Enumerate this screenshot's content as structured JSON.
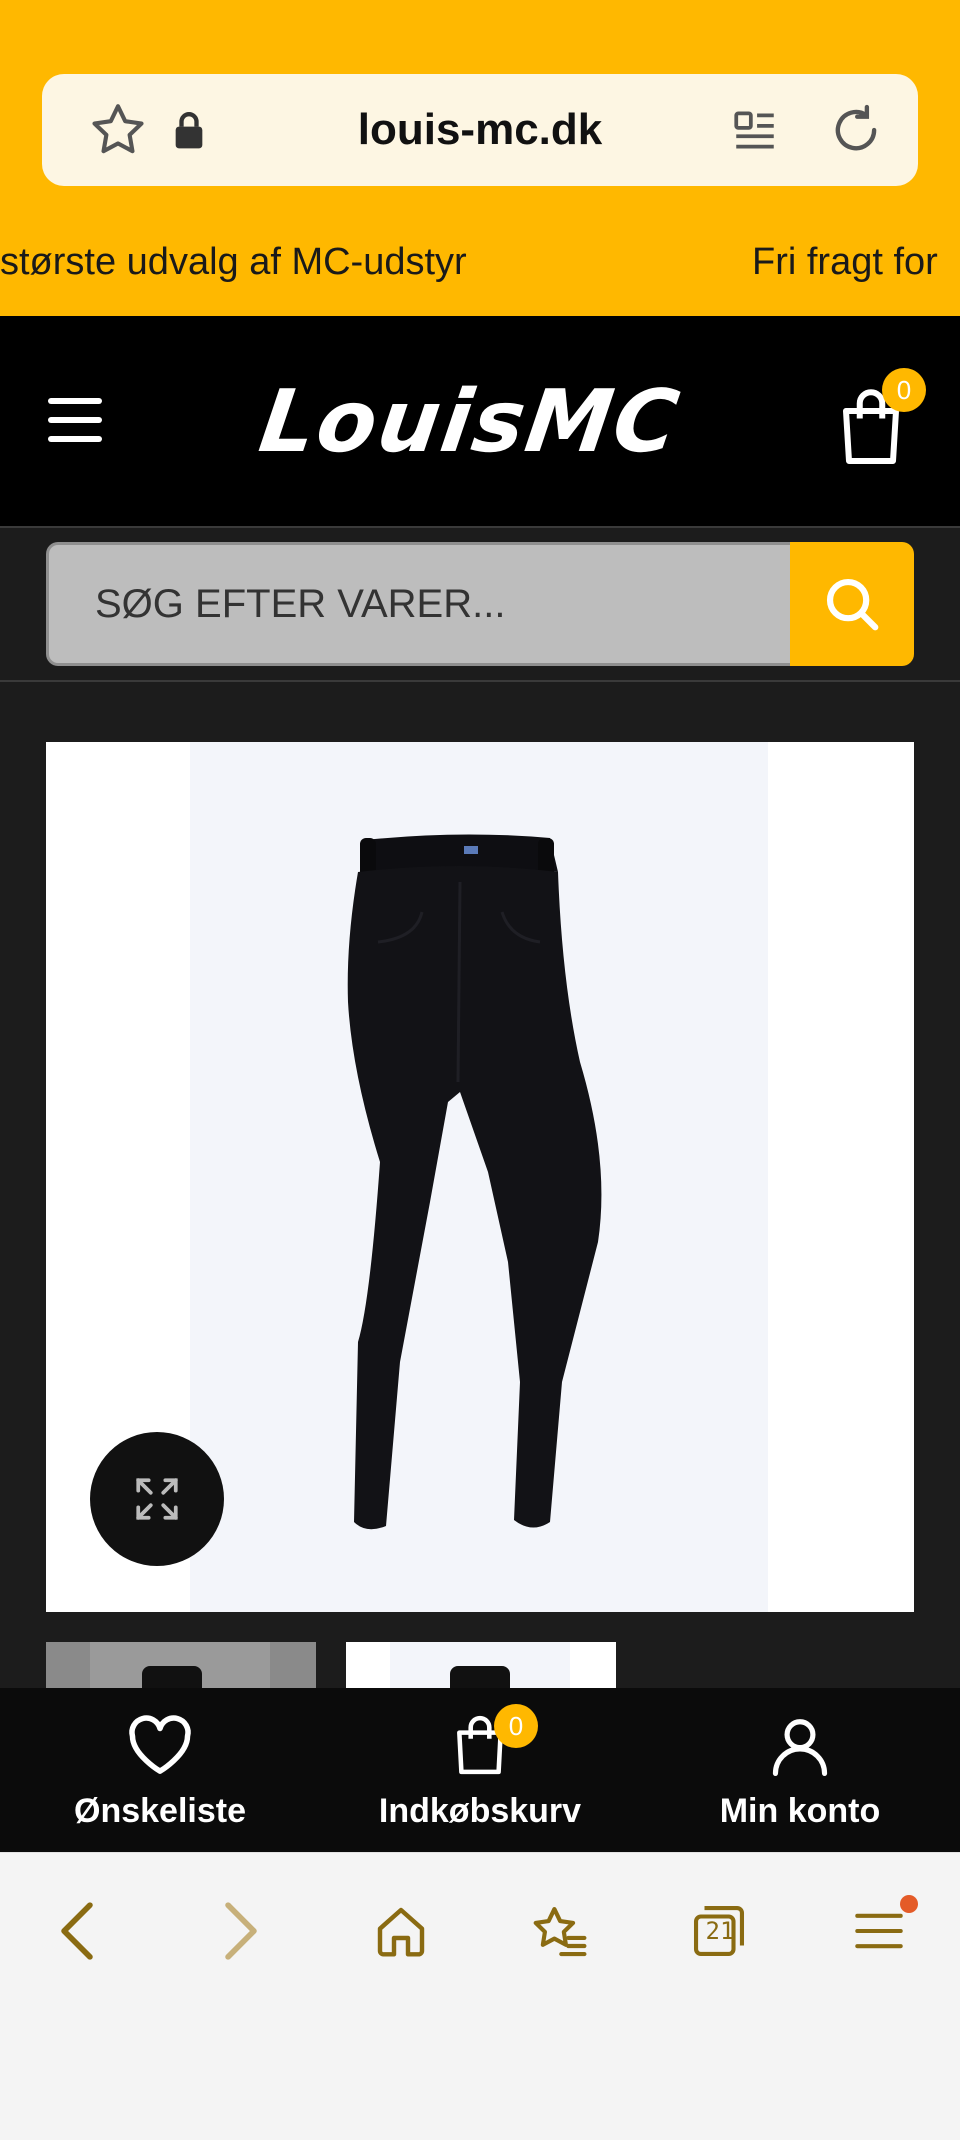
{
  "browser": {
    "url": "louis-mc.dk",
    "tab_count": "21",
    "icons": [
      "star-icon",
      "lock-icon",
      "reader-mode-icon",
      "reload-icon"
    ]
  },
  "promo": {
    "items": [
      "største udvalg af MC-udstyr",
      "Fri fragt for"
    ]
  },
  "header": {
    "logo_text": "LouisMC",
    "cart_count": "0"
  },
  "search": {
    "placeholder": "SØG EFTER VARER..."
  },
  "product": {
    "image_alt": "black motorcycle leggings",
    "zoom_icon": "expand-icon"
  },
  "bottom_nav": {
    "items": [
      {
        "label": "Ønskeliste",
        "icon": "heart-icon"
      },
      {
        "label": "Indkøbskurv",
        "icon": "shopping-bag-icon",
        "badge": "0"
      },
      {
        "label": "Min konto",
        "icon": "user-icon"
      }
    ]
  },
  "browser_nav": {
    "icons": [
      "back-icon",
      "forward-icon",
      "home-icon",
      "bookmarks-icon",
      "tabs-icon",
      "menu-icon"
    ]
  },
  "colors": {
    "accent": "#ffb800",
    "header_bg": "#000000",
    "page_bg": "#1c1c1c",
    "browser_icon": "#8a6b12"
  }
}
